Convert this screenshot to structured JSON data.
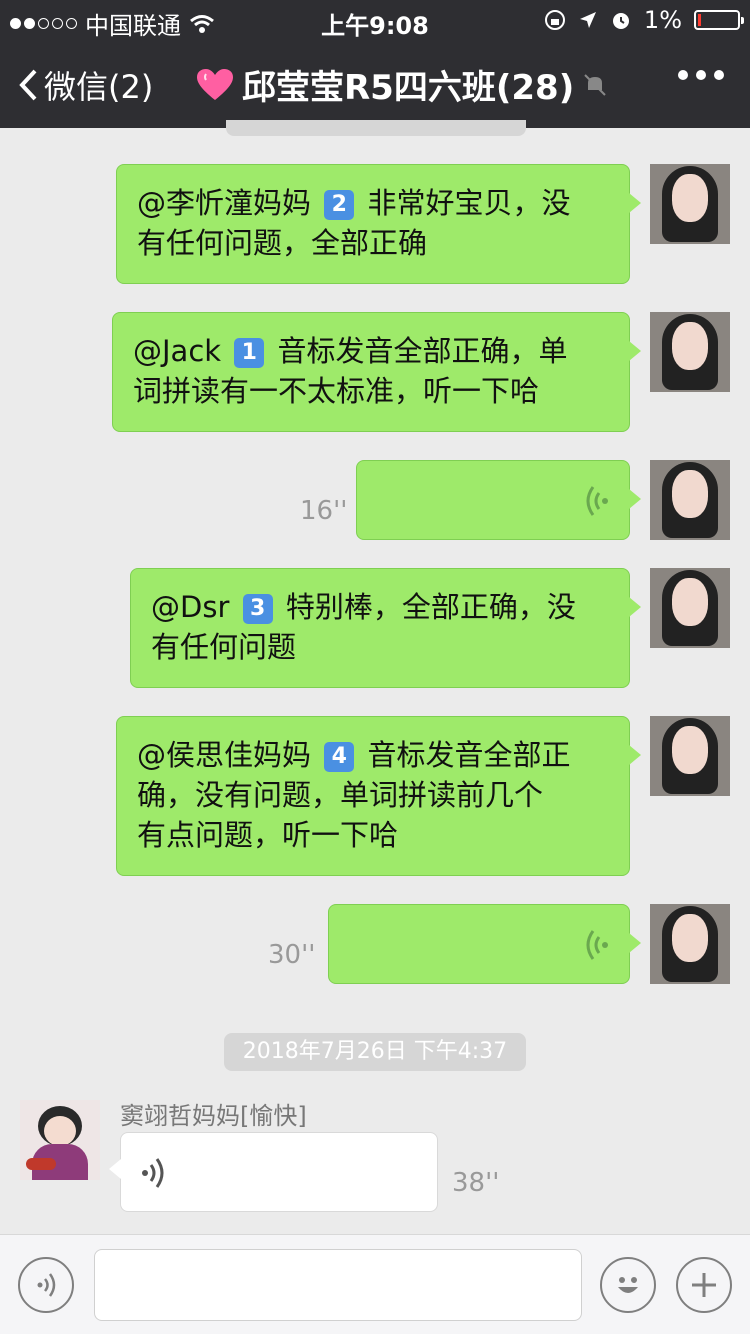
{
  "status_bar": {
    "carrier": "中国联通",
    "time": "上午9:08",
    "battery": "1%"
  },
  "nav": {
    "back_label": "微信(2)",
    "chat_title": "邱莹莹R5四六班(28)"
  },
  "messages": [
    {
      "mention": "@李忻潼妈妈",
      "badge": "2",
      "text_lines": [
        "非常好宝贝，没",
        "有任何问题，全部正确"
      ]
    },
    {
      "mention": "@Jack",
      "badge": "1",
      "text_lines": [
        "音标发音全部正确，单",
        "词拼读有一不太标准，听一下哈"
      ]
    },
    {
      "voice_length": "16''"
    },
    {
      "mention": "@Dsr",
      "badge": "3",
      "text_lines": [
        "特别棒，全部正确，没",
        "有任何问题"
      ]
    },
    {
      "mention": "@侯思佳妈妈",
      "badge": "4",
      "text_lines": [
        "音标发音全部正",
        "确，没有问题，单词拼读前几个",
        "有点问题，听一下哈"
      ]
    },
    {
      "voice_length": "30''"
    }
  ],
  "timestamp": "2018年7月26日 下午4:37",
  "incoming": {
    "sender": "窦翊哲妈妈[愉快]",
    "voice_length": "38''"
  },
  "colors": {
    "bubble_me": "#9eea6a",
    "nav_bg": "#2e2e32",
    "chat_bg": "#ebebeb"
  }
}
